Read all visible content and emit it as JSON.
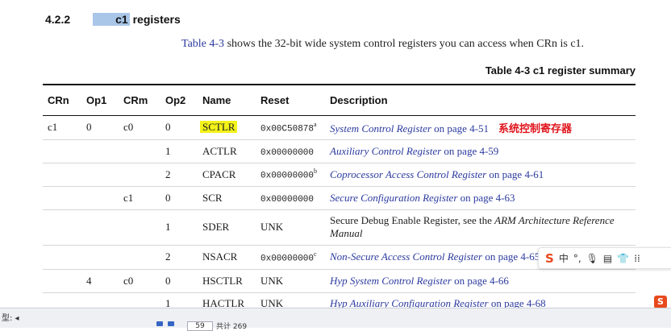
{
  "section": {
    "number": "4.2.2",
    "title_highlight": "c1",
    "title_rest": " registers"
  },
  "intro": {
    "link": "Table 4-3",
    "text": " shows the 32-bit wide system control registers you can access when CRn is c1."
  },
  "caption": "Table 4-3 c1 register summary",
  "table": {
    "headers": [
      "CRn",
      "Op1",
      "CRm",
      "Op2",
      "Name",
      "Reset",
      "Description"
    ],
    "rows": [
      {
        "crn": "c1",
        "op1": "0",
        "crm": "c0",
        "op2": "0",
        "name": "SCTLR",
        "reset": "0x00C50878",
        "reset_sup": "a",
        "desc_italic": "System Control Register",
        "desc_rest": " on page 4-51",
        "annotation": "系统控制寄存器"
      },
      {
        "crn": "",
        "op1": "",
        "crm": "",
        "op2": "1",
        "name": "ACTLR",
        "reset": "0x00000000",
        "reset_sup": "",
        "desc_italic": "Auxiliary Control Register",
        "desc_rest": " on page 4-59"
      },
      {
        "crn": "",
        "op1": "",
        "crm": "",
        "op2": "2",
        "name": "CPACR",
        "reset": "0x00000000",
        "reset_sup": "b",
        "desc_italic": "Coprocessor Access Control Register",
        "desc_rest": " on page 4-61"
      },
      {
        "crn": "",
        "op1": "",
        "crm": "c1",
        "op2": "0",
        "name": "SCR",
        "reset": "0x00000000",
        "reset_sup": "",
        "desc_italic": "Secure Configuration Register",
        "desc_rest": " on page 4-63"
      },
      {
        "crn": "",
        "op1": "",
        "crm": "",
        "op2": "1",
        "name": "SDER",
        "reset": "UNK",
        "reset_sup": "",
        "desc_plain": "Secure Debug Enable Register, see the ",
        "desc_plain_italic": "ARM Architecture Reference Manual"
      },
      {
        "crn": "",
        "op1": "",
        "crm": "",
        "op2": "2",
        "name": "NSACR",
        "reset": "0x00000000",
        "reset_sup": "c",
        "desc_italic": "Non-Secure Access Control Register",
        "desc_rest": " on page 4-65"
      },
      {
        "crn": "",
        "op1": "4",
        "crm": "c0",
        "op2": "0",
        "name": "HSCTLR",
        "reset": "UNK",
        "reset_sup": "",
        "desc_italic": "Hyp System Control Register",
        "desc_rest": " on page 4-66"
      },
      {
        "crn": "",
        "op1": "",
        "crm": "",
        "op2": "1",
        "name": "HACTLR",
        "reset": "UNK",
        "reset_sup": "",
        "desc_italic": "Hyp Auxiliary Configuration Register",
        "desc_rest": " on page 4-68"
      }
    ]
  },
  "ime_toolbar": {
    "logo": "S",
    "items": [
      "中",
      "°,",
      "🎙",
      "▤",
      "👕",
      "⁞⁞"
    ]
  },
  "viewer": {
    "left_label": "型: ◂",
    "page": "59",
    "total": "共计 269"
  },
  "colors": {
    "link": "#2b3a9e",
    "highlight_name": "#f3f21a",
    "highlight_heading": "#a9c6e8",
    "annotation": "#e0141c"
  }
}
